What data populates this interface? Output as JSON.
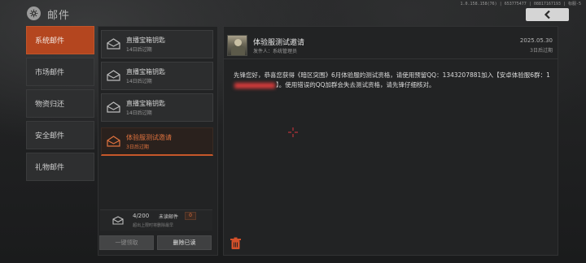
{
  "header": {
    "title": "邮件",
    "device_info": "1.0.158.158(76) | 653775477 | 08817167193 | 标服-5",
    "back_icon": "chevron-left-icon"
  },
  "nav": {
    "items": [
      {
        "label": "系统邮件",
        "active": true
      },
      {
        "label": "市场邮件",
        "active": false
      },
      {
        "label": "物资归还",
        "active": false
      },
      {
        "label": "安全邮件",
        "active": false
      },
      {
        "label": "礼物邮件",
        "active": false
      }
    ]
  },
  "mail_list": {
    "items": [
      {
        "subject": "直播宝箱钥匙",
        "expire": "14日后过期",
        "active": false
      },
      {
        "subject": "直播宝箱钥匙",
        "expire": "14日后过期",
        "active": false
      },
      {
        "subject": "直播宝箱钥匙",
        "expire": "14日后过期",
        "active": false
      },
      {
        "subject": "体验服测试邀请",
        "expire": "3日后过期",
        "active": true
      }
    ],
    "stats": {
      "count": "4/200",
      "unread_label": "未读邮件",
      "unread_count": "0",
      "note": "超出上限时将删除最早"
    },
    "claim_all_label": "一键领取",
    "delete_read_label": "删除已读"
  },
  "detail": {
    "subject": "体验服测试邀请",
    "sender": "发件人：系统管理员",
    "date": "2025.05.30",
    "expire": "3日后过期",
    "body_part1": "先锋您好，恭喜您获得《暗区突围》6月体验服的测试资格，请使用预留QQ：1343207881加入【安卓体验服6群：1",
    "body_part2": "】。使用错误的QQ加群会失去测试资格，请先锋仔细核对。"
  },
  "colors": {
    "accent": "#b4461f",
    "accent_text": "#e0733f",
    "panel": "#222324"
  }
}
